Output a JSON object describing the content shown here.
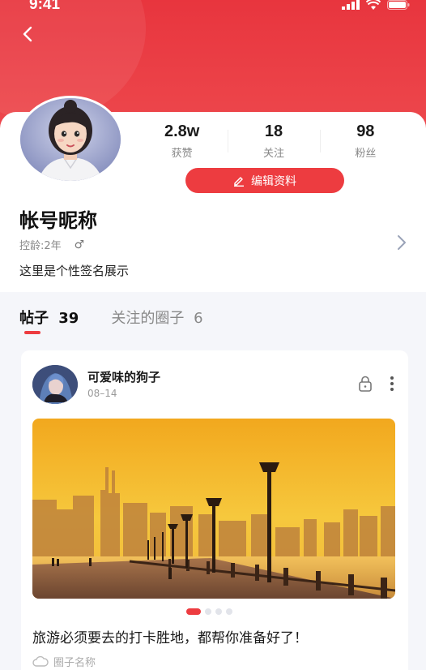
{
  "status_bar": {
    "time": "9:41"
  },
  "profile": {
    "nickname": "帐号昵称",
    "account_age": "控龄:2年",
    "gender_symbol": "♂",
    "bio": "这里是个性签名展示",
    "edit_button_label": "编辑资料"
  },
  "stats": [
    {
      "value": "2.8w",
      "label": "获赞"
    },
    {
      "value": "18",
      "label": "关注"
    },
    {
      "value": "98",
      "label": "粉丝"
    }
  ],
  "tabs": [
    {
      "label": "帖子",
      "count": "39",
      "active": true
    },
    {
      "label": "关注的圈子",
      "count": "6",
      "active": false
    }
  ],
  "post": {
    "author": "可爱味的狗子",
    "date": "08–14",
    "title": "旅游必须要去的打卡胜地，都帮你准备好了！",
    "circle_name": "圈子名称",
    "image_count": 4,
    "active_image_index": 0
  },
  "colors": {
    "accent": "#ed3c40",
    "header_top": "#e8353e"
  },
  "icons": [
    "back-chevron-icon",
    "signal-icon",
    "wifi-icon",
    "battery-icon",
    "pencil-icon",
    "chevron-right-icon",
    "lock-icon",
    "more-vertical-icon",
    "circle-cloud-icon"
  ]
}
